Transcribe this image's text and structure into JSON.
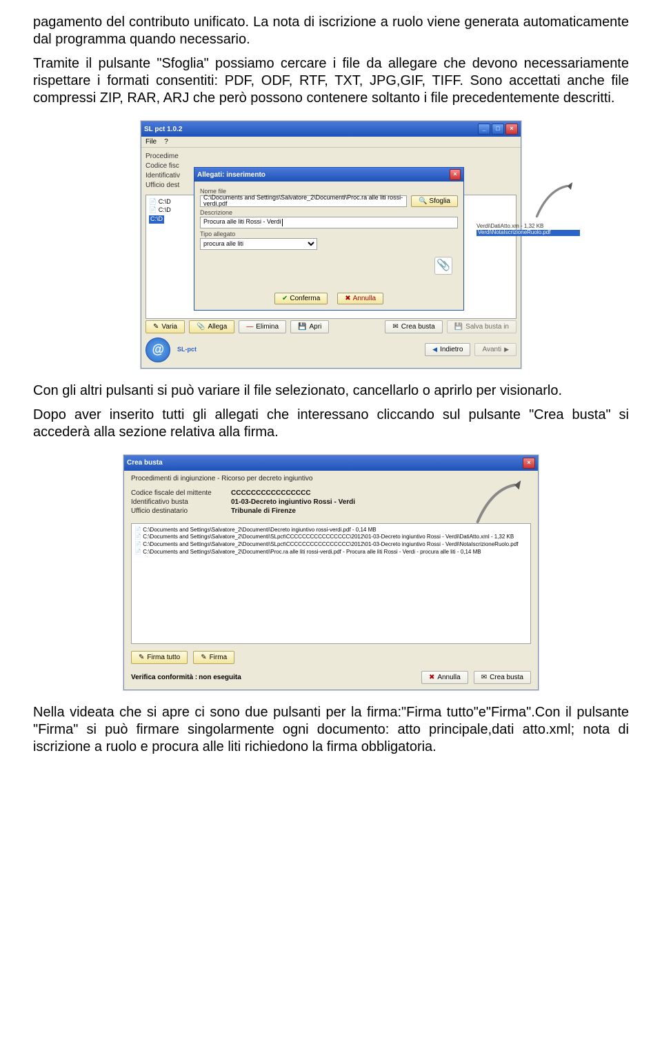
{
  "para1": "pagamento del contributo unificato. La nota di iscrizione a ruolo viene generata automaticamente dal programma quando necessario.",
  "para2": "Tramite il pulsante \"Sfoglia\" possiamo cercare i file da allegare che devono necessariamente rispettare i formati consentiti: PDF, ODF, RTF, TXT, JPG,GIF, TIFF. Sono accettati anche file compressi ZIP, RAR, ARJ che però possono contenere soltanto i file precedentemente descritti.",
  "para3": "Con gli altri pulsanti si può variare il file selezionato, cancellarlo o aprirlo per visionarlo.",
  "para4": "Dopo aver inserito tutti gli allegati che interessano cliccando sul pulsante \"Crea busta\" si accederà alla sezione relativa alla firma.",
  "para5": "Nella videata che si apre ci sono due pulsanti  per la firma:\"Firma tutto\"e\"Firma\".Con il pulsante \"Firma\" si può firmare singolarmente ogni documento: atto principale,dati atto.xml; nota di iscrizione a ruolo e procura alle liti richiedono la firma obbligatoria.",
  "s1": {
    "title": "SL pct 1.0.2",
    "menu_file": "File",
    "menu_q": "?",
    "lab_proc": "Procedime",
    "lab_cf": "Codice fisc",
    "lab_id": "Identificativ",
    "lab_uff": "Ufficio dest",
    "tree0": "C:\\D",
    "tree1": "C:\\D",
    "tree2": "C:\\D",
    "rf1": "Verdi\\DatiAtto.xm - 1,32 KB",
    "rf2": "Verdi\\NotaIscrizioneRuolo.pdf",
    "dialog_title": "Allegati: inserimento",
    "lab_nome": "Nome file",
    "val_nome": "C:\\Documents and Settings\\Salvatore_2\\Documenti\\Proc.ra alle liti rossi-verdi.pdf",
    "btn_sfoglia": "Sfoglia",
    "lab_desc": "Descrizione",
    "val_desc": "Procura alle liti Rossi - Verdi",
    "lab_tipo": "Tipo allegato",
    "val_tipo": "procura alle liti",
    "btn_conferma": "Conferma",
    "btn_annulla": "Annulla",
    "btn_varia": "Varia",
    "btn_allega": "Allega",
    "btn_elimina": "Elimina",
    "btn_apri": "Apri",
    "btn_crea": "Crea busta",
    "btn_salva": "Salva busta in",
    "btn_indietro": "Indietro",
    "btn_avanti": "Avanti",
    "brand": "SL-pct"
  },
  "s2": {
    "title": "Crea busta",
    "hdr": "Procedimenti di ingiunzione - Ricorso per decreto ingiuntivo",
    "mk_cf": "Codice fiscale del mittente",
    "mv_cf": "CCCCCCCCCCCCCCCC",
    "mk_id": "Identificativo busta",
    "mv_id": "01-03-Decreto ingiuntivo Rossi - Verdi",
    "mk_uff": "Ufficio destinatario",
    "mv_uff": "Tribunale di Firenze",
    "f1": "C:\\Documents and Settings\\Salvatore_2\\Documenti\\Decreto ingiuntivo rossi-verdi.pdf - 0,14 MB",
    "f2": "C:\\Documents and Settings\\Salvatore_2\\Documenti\\SLpct\\CCCCCCCCCCCCCCCC\\2012\\01-03-Decreto ingiuntivo Rossi - Verdi\\DatiAtto.xml - 1,32 KB",
    "f3": "C:\\Documents and Settings\\Salvatore_2\\Documenti\\SLpct\\CCCCCCCCCCCCCCCC\\2012\\01-03-Decreto ingiuntivo Rossi - Verdi\\NotaIscrizioneRuolo.pdf",
    "f4": "C:\\Documents and Settings\\Salvatore_2\\Documenti\\Proc.ra alle liti rossi-verdi.pdf - Procura alle liti Rossi - Verdi - procura alle liti - 0,14 MB",
    "btn_firma_tutto": "Firma tutto",
    "btn_firma": "Firma",
    "verify_lab": "Verifica conformità :",
    "verify_stat": "non eseguita",
    "btn_annulla": "Annulla",
    "btn_crea": "Crea busta"
  }
}
